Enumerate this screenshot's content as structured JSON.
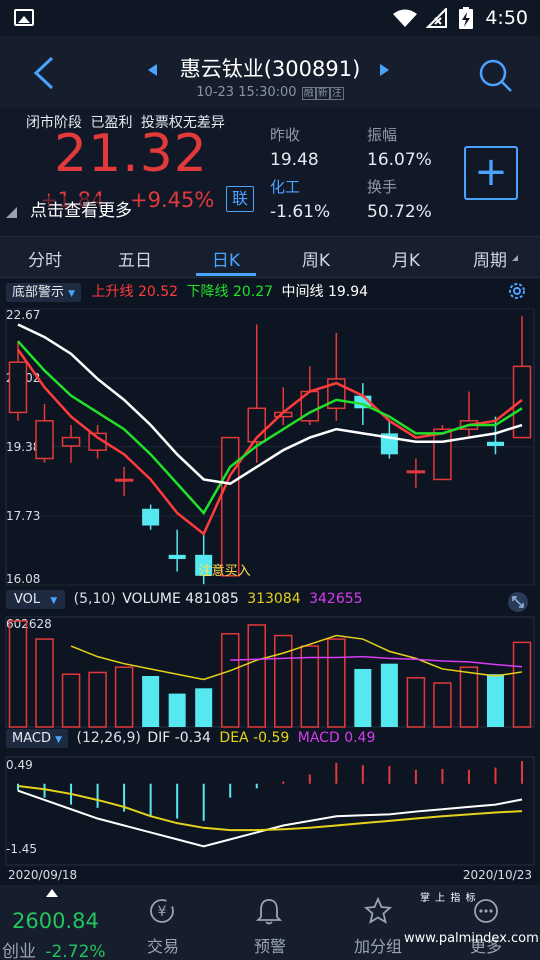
{
  "status_bar": {
    "time": "4:50"
  },
  "header": {
    "title": "惠云钛业(300891)",
    "datetime": "10-23 15:30:00",
    "badges": [
      "融",
      "新",
      "注"
    ]
  },
  "quote": {
    "phase": "闭市阶段",
    "profit": "已盈利",
    "voting": "投票权无差异",
    "price": "21.32",
    "change": "+1.84",
    "change_pct": "+9.45%",
    "link_label": "联",
    "more": "点击查看更多",
    "stats": [
      {
        "label": "昨收",
        "value": "19.48"
      },
      {
        "label": "振幅",
        "value": "16.07%"
      },
      {
        "label": "化工",
        "value": "-1.61%"
      },
      {
        "label": "换手",
        "value": "50.72%"
      }
    ],
    "add_button": "+"
  },
  "tabs": [
    "分时",
    "五日",
    "日K",
    "周K",
    "月K",
    "周期"
  ],
  "active_tab": "日K",
  "main_chart": {
    "indicator": "底部警示",
    "legend": [
      {
        "label": "上升线",
        "value": "20.52",
        "color": "#ff3b3b"
      },
      {
        "label": "下降线",
        "value": "20.27",
        "color": "#22e02a"
      },
      {
        "label": "中间线",
        "value": "19.94",
        "color": "#ffffff"
      }
    ],
    "y_labels": [
      "22.67",
      "21.02",
      "19.38",
      "17.73",
      "16.08"
    ],
    "annotation": "注意买入"
  },
  "vol_chart": {
    "indicator": "VOL",
    "params": "(5,10)",
    "legend": [
      {
        "label": "VOLUME",
        "value": "481085",
        "color": "#e6e9ef"
      },
      {
        "label": "",
        "value": "313084",
        "color": "#e6d21a"
      },
      {
        "label": "",
        "value": "342655",
        "color": "#d63cf0"
      }
    ],
    "y_max": "602628"
  },
  "macd_chart": {
    "indicator": "MACD",
    "params": "(12,26,9)",
    "legend": [
      {
        "label": "DIF",
        "value": "-0.34",
        "color": "#e6e9ef"
      },
      {
        "label": "DEA",
        "value": "-0.59",
        "color": "#e6d21a"
      },
      {
        "label": "MACD",
        "value": "0.49",
        "color": "#d63cf0"
      }
    ],
    "y_top": "0.49",
    "y_bottom": "-1.45",
    "date_start": "2020/09/18",
    "date_end": "2020/10/23"
  },
  "chart_data": {
    "type": "candlestick",
    "candles": [
      {
        "o": 20.2,
        "c": 21.4,
        "h": 21.9,
        "l": 20.0
      },
      {
        "o": 19.1,
        "c": 20.0,
        "h": 20.4,
        "l": 19.0
      },
      {
        "o": 19.4,
        "c": 19.6,
        "h": 19.9,
        "l": 19.0
      },
      {
        "o": 19.3,
        "c": 19.7,
        "h": 19.9,
        "l": 19.1
      },
      {
        "o": 18.6,
        "c": 18.6,
        "h": 18.9,
        "l": 18.2
      },
      {
        "o": 17.9,
        "c": 17.5,
        "h": 18.0,
        "l": 17.4
      },
      {
        "o": 16.8,
        "c": 16.7,
        "h": 17.4,
        "l": 16.4
      },
      {
        "o": 16.8,
        "c": 16.3,
        "h": 17.3,
        "l": 16.1
      },
      {
        "o": 16.3,
        "c": 19.6,
        "h": 19.6,
        "l": 16.3
      },
      {
        "o": 19.5,
        "c": 20.3,
        "h": 22.3,
        "l": 19.0
      },
      {
        "o": 20.1,
        "c": 20.2,
        "h": 20.8,
        "l": 19.9
      },
      {
        "o": 20.0,
        "c": 20.7,
        "h": 21.3,
        "l": 19.9
      },
      {
        "o": 20.3,
        "c": 21.0,
        "h": 22.1,
        "l": 20.0
      },
      {
        "o": 20.6,
        "c": 20.3,
        "h": 20.9,
        "l": 19.9
      },
      {
        "o": 19.7,
        "c": 19.2,
        "h": 20.0,
        "l": 19.1
      },
      {
        "o": 18.8,
        "c": 18.8,
        "h": 19.1,
        "l": 18.4
      },
      {
        "o": 18.6,
        "c": 19.8,
        "h": 19.9,
        "l": 18.6
      },
      {
        "o": 19.8,
        "c": 20.0,
        "h": 20.7,
        "l": 19.6
      },
      {
        "o": 19.5,
        "c": 19.4,
        "h": 20.1,
        "l": 19.2
      },
      {
        "o": 19.6,
        "c": 21.3,
        "h": 22.5,
        "l": 19.6
      }
    ],
    "lines": {
      "上升线": [
        21.7,
        20.8,
        20.1,
        19.6,
        19.2,
        18.6,
        17.8,
        17.3,
        18.7,
        19.6,
        20.2,
        20.7,
        20.9,
        20.6,
        20.0,
        19.6,
        19.7,
        19.9,
        20.0,
        20.5
      ],
      "下降线": [
        21.9,
        21.2,
        20.6,
        20.2,
        19.8,
        19.2,
        18.5,
        17.8,
        18.9,
        19.4,
        19.8,
        20.2,
        20.5,
        20.4,
        20.1,
        19.7,
        19.7,
        19.9,
        19.9,
        20.3
      ],
      "中间线": [
        22.3,
        22.0,
        21.6,
        21.0,
        20.5,
        19.9,
        19.2,
        18.6,
        18.5,
        18.9,
        19.3,
        19.6,
        19.8,
        19.7,
        19.6,
        19.5,
        19.5,
        19.6,
        19.7,
        19.9
      ]
    },
    "volume": {
      "values": [
        602628,
        500000,
        300000,
        310000,
        340000,
        290000,
        190000,
        220000,
        530000,
        580000,
        520000,
        460000,
        500000,
        330000,
        360000,
        280000,
        250000,
        340000,
        300000,
        481085
      ],
      "ma5": [
        null,
        null,
        460000,
        400000,
        360000,
        330000,
        300000,
        270000,
        320000,
        380000,
        420000,
        470000,
        520000,
        500000,
        430000,
        390000,
        330000,
        310000,
        290000,
        313084
      ],
      "ma10": [
        null,
        null,
        null,
        null,
        null,
        null,
        null,
        null,
        380000,
        385000,
        390000,
        395000,
        395000,
        400000,
        390000,
        385000,
        375000,
        370000,
        355000,
        342655
      ]
    },
    "macd": {
      "hist": [
        -0.15,
        -0.3,
        -0.45,
        -0.52,
        -0.6,
        -0.7,
        -0.75,
        -0.8,
        -0.3,
        -0.1,
        0.05,
        0.2,
        0.45,
        0.4,
        0.38,
        0.3,
        0.32,
        0.3,
        0.35,
        0.49
      ],
      "dif": [
        -0.15,
        -0.35,
        -0.55,
        -0.75,
        -0.9,
        -1.05,
        -1.2,
        -1.35,
        -1.2,
        -1.05,
        -0.9,
        -0.8,
        -0.7,
        -0.68,
        -0.66,
        -0.6,
        -0.55,
        -0.5,
        -0.45,
        -0.34
      ],
      "dea": [
        -0.05,
        -0.12,
        -0.22,
        -0.35,
        -0.5,
        -0.7,
        -0.85,
        -0.95,
        -1.0,
        -1.0,
        -0.98,
        -0.95,
        -0.9,
        -0.85,
        -0.8,
        -0.75,
        -0.7,
        -0.66,
        -0.62,
        -0.59
      ]
    },
    "price_range": [
      16.08,
      22.67
    ],
    "volume_max": 602628,
    "macd_range": [
      -1.45,
      0.49
    ]
  },
  "bottom_nav": {
    "index_value": "2600.84",
    "index_name": "创业",
    "index_change": "-2.72%",
    "items": [
      "交易",
      "预警",
      "加分组",
      "更多"
    ],
    "watermark_top": "掌 上 指 标",
    "watermark_url": "www.palmindex.com"
  },
  "colors": {
    "up": "#e23a3a",
    "down": "#56e8f0",
    "accent": "#4aa3ff"
  }
}
